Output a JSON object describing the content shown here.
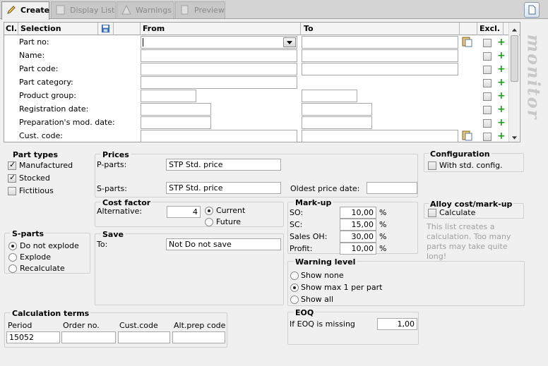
{
  "tabs": {
    "create": "Create",
    "display_list": "Display List",
    "warnings": "Warnings",
    "preview": "Preview"
  },
  "grid": {
    "headers": {
      "cl": "Cl.",
      "selection": "Selection",
      "from": "From",
      "to": "To",
      "excl": "Excl."
    },
    "rows": [
      {
        "label": "Part no:"
      },
      {
        "label": "Name:"
      },
      {
        "label": "Part code:"
      },
      {
        "label": "Part category:"
      },
      {
        "label": "Product group:"
      },
      {
        "label": "Registration date:"
      },
      {
        "label": "Preparation's mod. date:"
      },
      {
        "label": "Cust. code:"
      }
    ],
    "plus": "+"
  },
  "brand": "MONITOR",
  "part_types": {
    "title": "Part types",
    "manufactured": "Manufactured",
    "stocked": "Stocked",
    "fictitious": "Fictitious"
  },
  "prices": {
    "title": "Prices",
    "p_parts_label": "P-parts:",
    "p_parts_value": "STP  Std. price",
    "s_parts_label": "S-parts:",
    "s_parts_value": "STP  Std. price",
    "oldest_label": "Oldest price date:",
    "oldest_value": ""
  },
  "configuration": {
    "title": "Configuration",
    "with_std": "With std. config."
  },
  "cost_factor": {
    "title": "Cost factor",
    "alternative_label": "Alternative:",
    "alternative_value": "4",
    "current": "Current",
    "future": "Future"
  },
  "markup": {
    "title": "Mark-up",
    "rows": [
      {
        "label": "SO:",
        "value": "10,00",
        "unit": "%"
      },
      {
        "label": "SC:",
        "value": "15,00",
        "unit": "%"
      },
      {
        "label": "Sales OH:",
        "value": "30,00",
        "unit": "%"
      },
      {
        "label": "Profit:",
        "value": "10,00",
        "unit": "%"
      }
    ]
  },
  "alloy": {
    "title": "Alloy cost/mark-up",
    "calculate": "Calculate",
    "note": "This list creates a calculation. Too many parts may take quite long!"
  },
  "sparts": {
    "title": "S-parts",
    "do_not_explode": "Do not explode",
    "explode": "Explode",
    "recalculate": "Recalculate"
  },
  "save": {
    "title": "Save",
    "to_label": "To:",
    "to_value": "Not  Do not save"
  },
  "warning": {
    "title": "Warning level",
    "show_none": "Show none",
    "show_max": "Show max 1 per part",
    "show_all": "Show all"
  },
  "calc_terms": {
    "title": "Calculation terms",
    "period_label": "Period",
    "order_label": "Order no.",
    "cust_label": "Cust.code",
    "alt_label": "Alt.prep code",
    "period_value": "15052",
    "order_value": "",
    "cust_value": "",
    "alt_value": ""
  },
  "eoq": {
    "title": "EOQ",
    "missing_label": "If EOQ is missing",
    "missing_value": "1,00"
  }
}
